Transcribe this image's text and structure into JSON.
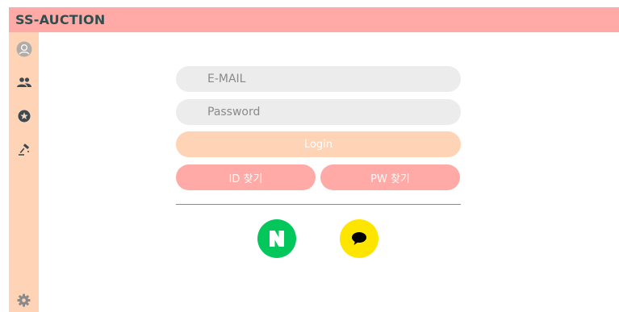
{
  "header": {
    "title": "SS-AUCTION"
  },
  "sidebar": {
    "items": [
      {
        "icon": "user-avatar-icon"
      },
      {
        "icon": "people-icon"
      },
      {
        "icon": "star-badge-icon"
      },
      {
        "icon": "auction-gavel-icon"
      }
    ],
    "footer_icon": "gear-icon"
  },
  "login": {
    "email_placeholder": "E-MAIL",
    "password_placeholder": "Password",
    "login_label": "Login",
    "find_id_label": "ID 찾기",
    "find_pw_label": "PW 찾기"
  },
  "social": {
    "naver_letter": "N",
    "naver_color": "#03c75a",
    "kakao_color": "#fee500",
    "kakao_icon": "speech-bubble-icon"
  },
  "colors": {
    "header": "#ffaaa6",
    "sidebar": "#ffd3b6",
    "field": "#ececec",
    "title": "#2f4f4f"
  }
}
